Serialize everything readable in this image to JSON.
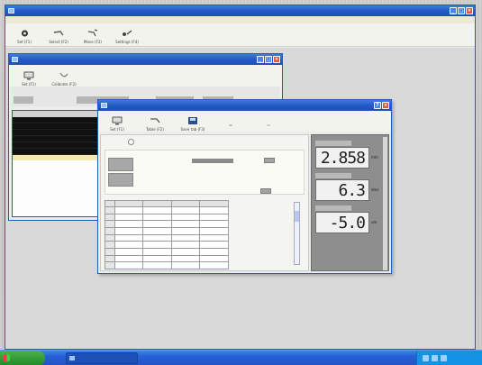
{
  "colors": {
    "titlebar": "#2459c6",
    "taskbar": "#2660d8",
    "start_button": "#2f9a35",
    "lcd_background": "#f1f1f1",
    "readout_panel": "#8e8e8e"
  },
  "main_window": {
    "toolbar": [
      {
        "icon": "gear-icon",
        "label": "Set (F1)"
      },
      {
        "icon": "select-icon",
        "label": "Select (F2)"
      },
      {
        "icon": "move-icon",
        "label": "Move (F3)"
      },
      {
        "icon": "settings-icon",
        "label": "Settings (F4)"
      }
    ]
  },
  "list_window": {
    "toolbar": [
      {
        "icon": "computer-icon",
        "label": "Set (F1)"
      },
      {
        "icon": "calibrate-icon",
        "label": "Calibrate (F2)"
      }
    ]
  },
  "measure_window": {
    "toolbar": [
      {
        "icon": "computer-icon",
        "label": "Set (F1)"
      },
      {
        "icon": "table-icon",
        "label": "Table (F2)"
      },
      {
        "icon": "save-icon",
        "label": "Save tab (F3)"
      }
    ],
    "readouts": [
      {
        "value": "2.858",
        "unit": "mm"
      },
      {
        "value": "6.3",
        "unit": "dms"
      },
      {
        "value": "-5.0",
        "unit": "um"
      }
    ]
  }
}
